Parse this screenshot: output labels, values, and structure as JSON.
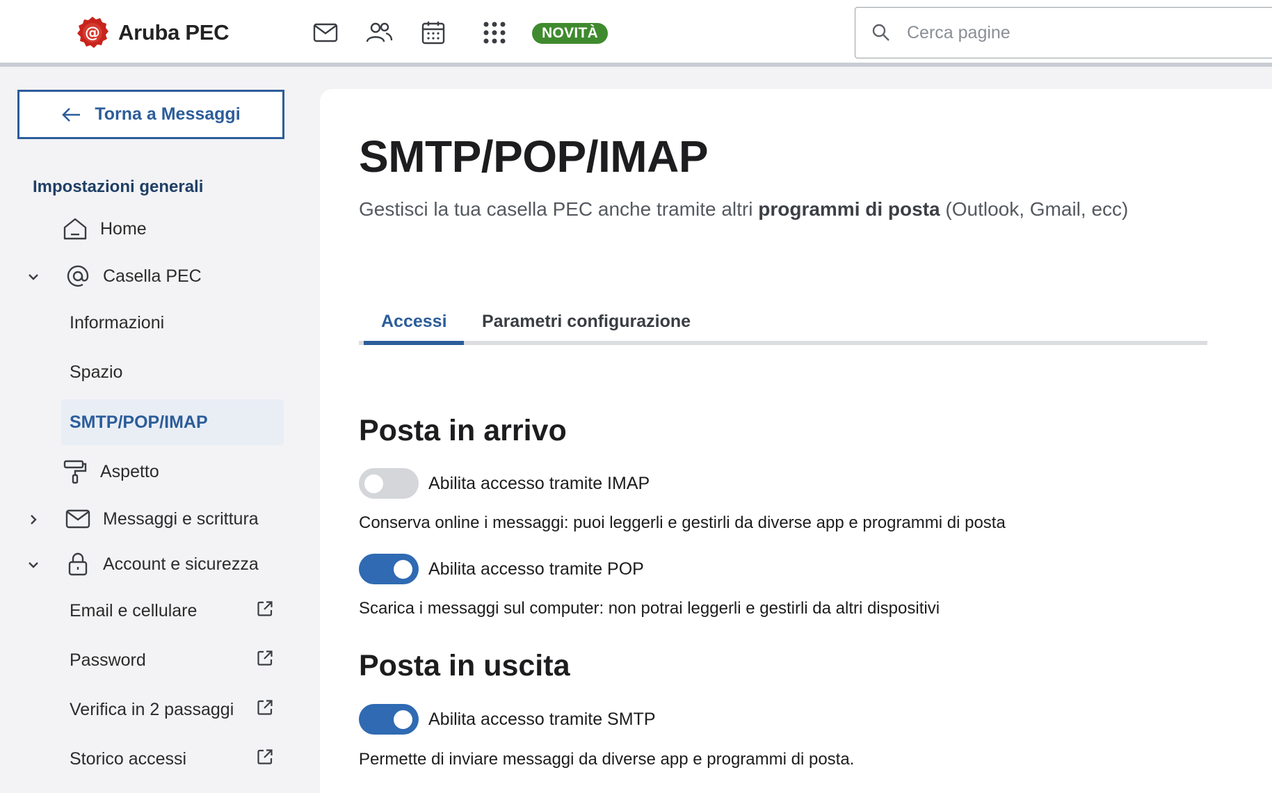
{
  "header": {
    "brand": "Aruba PEC",
    "badge": "NOVITÀ",
    "search_placeholder": "Cerca pagine",
    "icons": [
      "mail-icon",
      "contacts-icon",
      "calendar-icon",
      "apps-grid-icon"
    ]
  },
  "sidebar": {
    "back_label": "Torna a Messaggi",
    "section_title": "Impostazioni generali",
    "items": [
      {
        "label": "Home",
        "icon": "home-icon"
      },
      {
        "label": "Casella PEC",
        "icon": "at-icon",
        "expanded": true
      },
      {
        "label": "Informazioni"
      },
      {
        "label": "Spazio"
      },
      {
        "label": "SMTP/POP/IMAP",
        "active": true
      },
      {
        "label": "Aspetto",
        "icon": "paint-roller-icon"
      },
      {
        "label": "Messaggi e scrittura",
        "icon": "envelope-icon",
        "expanded": false
      },
      {
        "label": "Account e sicurezza",
        "icon": "lock-icon",
        "expanded": true
      },
      {
        "label": "Email e cellulare",
        "external": true
      },
      {
        "label": "Password",
        "external": true
      },
      {
        "label": "Verifica in 2 passaggi",
        "external": true
      },
      {
        "label": "Storico accessi",
        "external": true
      }
    ]
  },
  "main": {
    "title": "SMTP/POP/IMAP",
    "subtitle_pre": "Gestisci la tua casella PEC anche tramite altri ",
    "subtitle_bold": "programmi di posta",
    "subtitle_post": " (Outlook, Gmail, ecc)",
    "tabs": [
      {
        "label": "Accessi",
        "active": true
      },
      {
        "label": "Parametri configurazione",
        "active": false
      }
    ],
    "incoming": {
      "heading": "Posta in arrivo",
      "imap": {
        "label": "Abilita accesso tramite IMAP",
        "enabled": false,
        "desc": "Conserva online i messaggi: puoi leggerli e gestirli da diverse app e programmi di posta"
      },
      "pop": {
        "label": "Abilita accesso tramite POP",
        "enabled": true,
        "desc": "Scarica i messaggi sul computer: non potrai leggerli e gestirli da altri dispositivi"
      }
    },
    "outgoing": {
      "heading": "Posta in uscita",
      "smtp": {
        "label": "Abilita accesso tramite SMTP",
        "enabled": true,
        "desc": "Permette di inviare messaggi da diverse app e programmi di posta."
      }
    }
  },
  "colors": {
    "accent": "#2c5d9a",
    "toggle_on": "#2f6ab3",
    "toggle_off": "#d4d6da",
    "badge": "#3f8a2e",
    "brand_red": "#c8231d"
  }
}
